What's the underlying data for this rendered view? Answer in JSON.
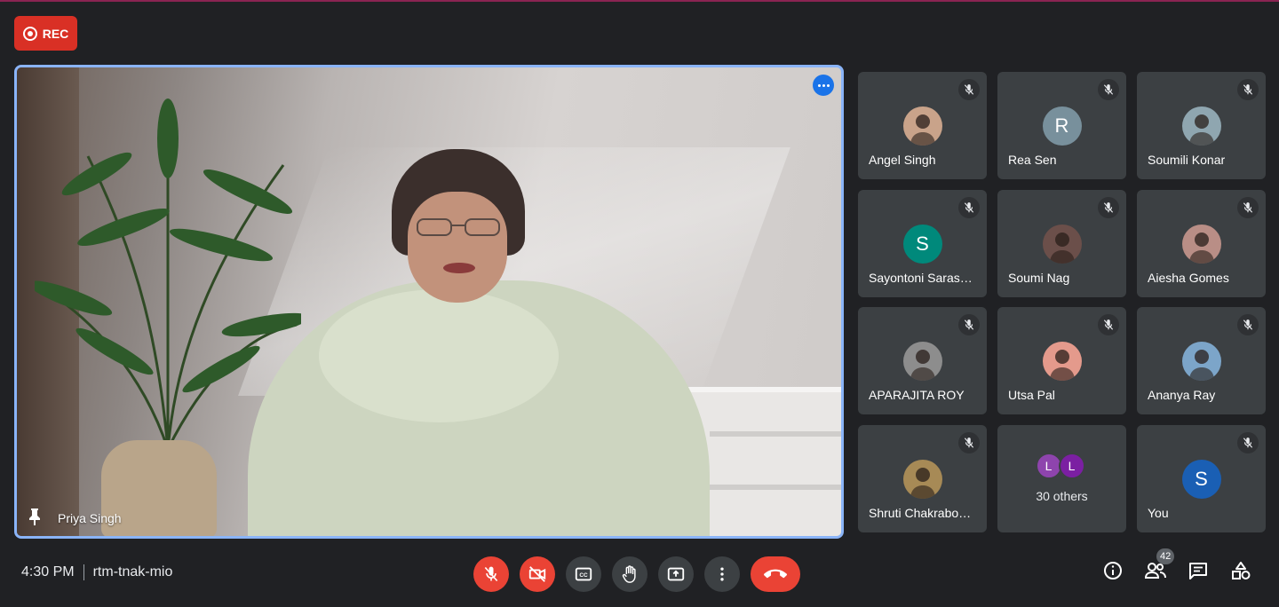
{
  "recording": {
    "label": "REC"
  },
  "main_speaker": {
    "name": "Priya Singh"
  },
  "participants": [
    {
      "name": "Angel Singh",
      "avatar": "photo",
      "color": "#c9a38a"
    },
    {
      "name": "Rea Sen",
      "avatar": "R",
      "color": "#78909c"
    },
    {
      "name": "Soumili Konar",
      "avatar": "photo",
      "color": "#8fa6b0"
    },
    {
      "name": "Sayontoni Saras…",
      "avatar": "S",
      "color": "#00897b"
    },
    {
      "name": "Soumi Nag",
      "avatar": "photo",
      "color": "#6b4f4a"
    },
    {
      "name": "Aiesha Gomes",
      "avatar": "photo",
      "color": "#b98e86"
    },
    {
      "name": "APARAJITA ROY",
      "avatar": "photo",
      "color": "#8d8d8d"
    },
    {
      "name": "Utsa Pal",
      "avatar": "photo",
      "color": "#e49a8c"
    },
    {
      "name": "Ananya Ray",
      "avatar": "photo",
      "color": "#7ca5c9"
    },
    {
      "name": "Shruti Chakrabo…",
      "avatar": "photo",
      "color": "#a78a56"
    }
  ],
  "others": {
    "label": "30 others",
    "avatars": [
      "L",
      "L"
    ],
    "colors": [
      "#8e44ad",
      "#7b1fa2"
    ]
  },
  "self_tile": {
    "name": "You",
    "avatar": "S",
    "color": "#1a5fb4"
  },
  "footer": {
    "time": "4:30 PM",
    "meeting_code": "rtm-tnak-mio"
  },
  "people_count": "42"
}
